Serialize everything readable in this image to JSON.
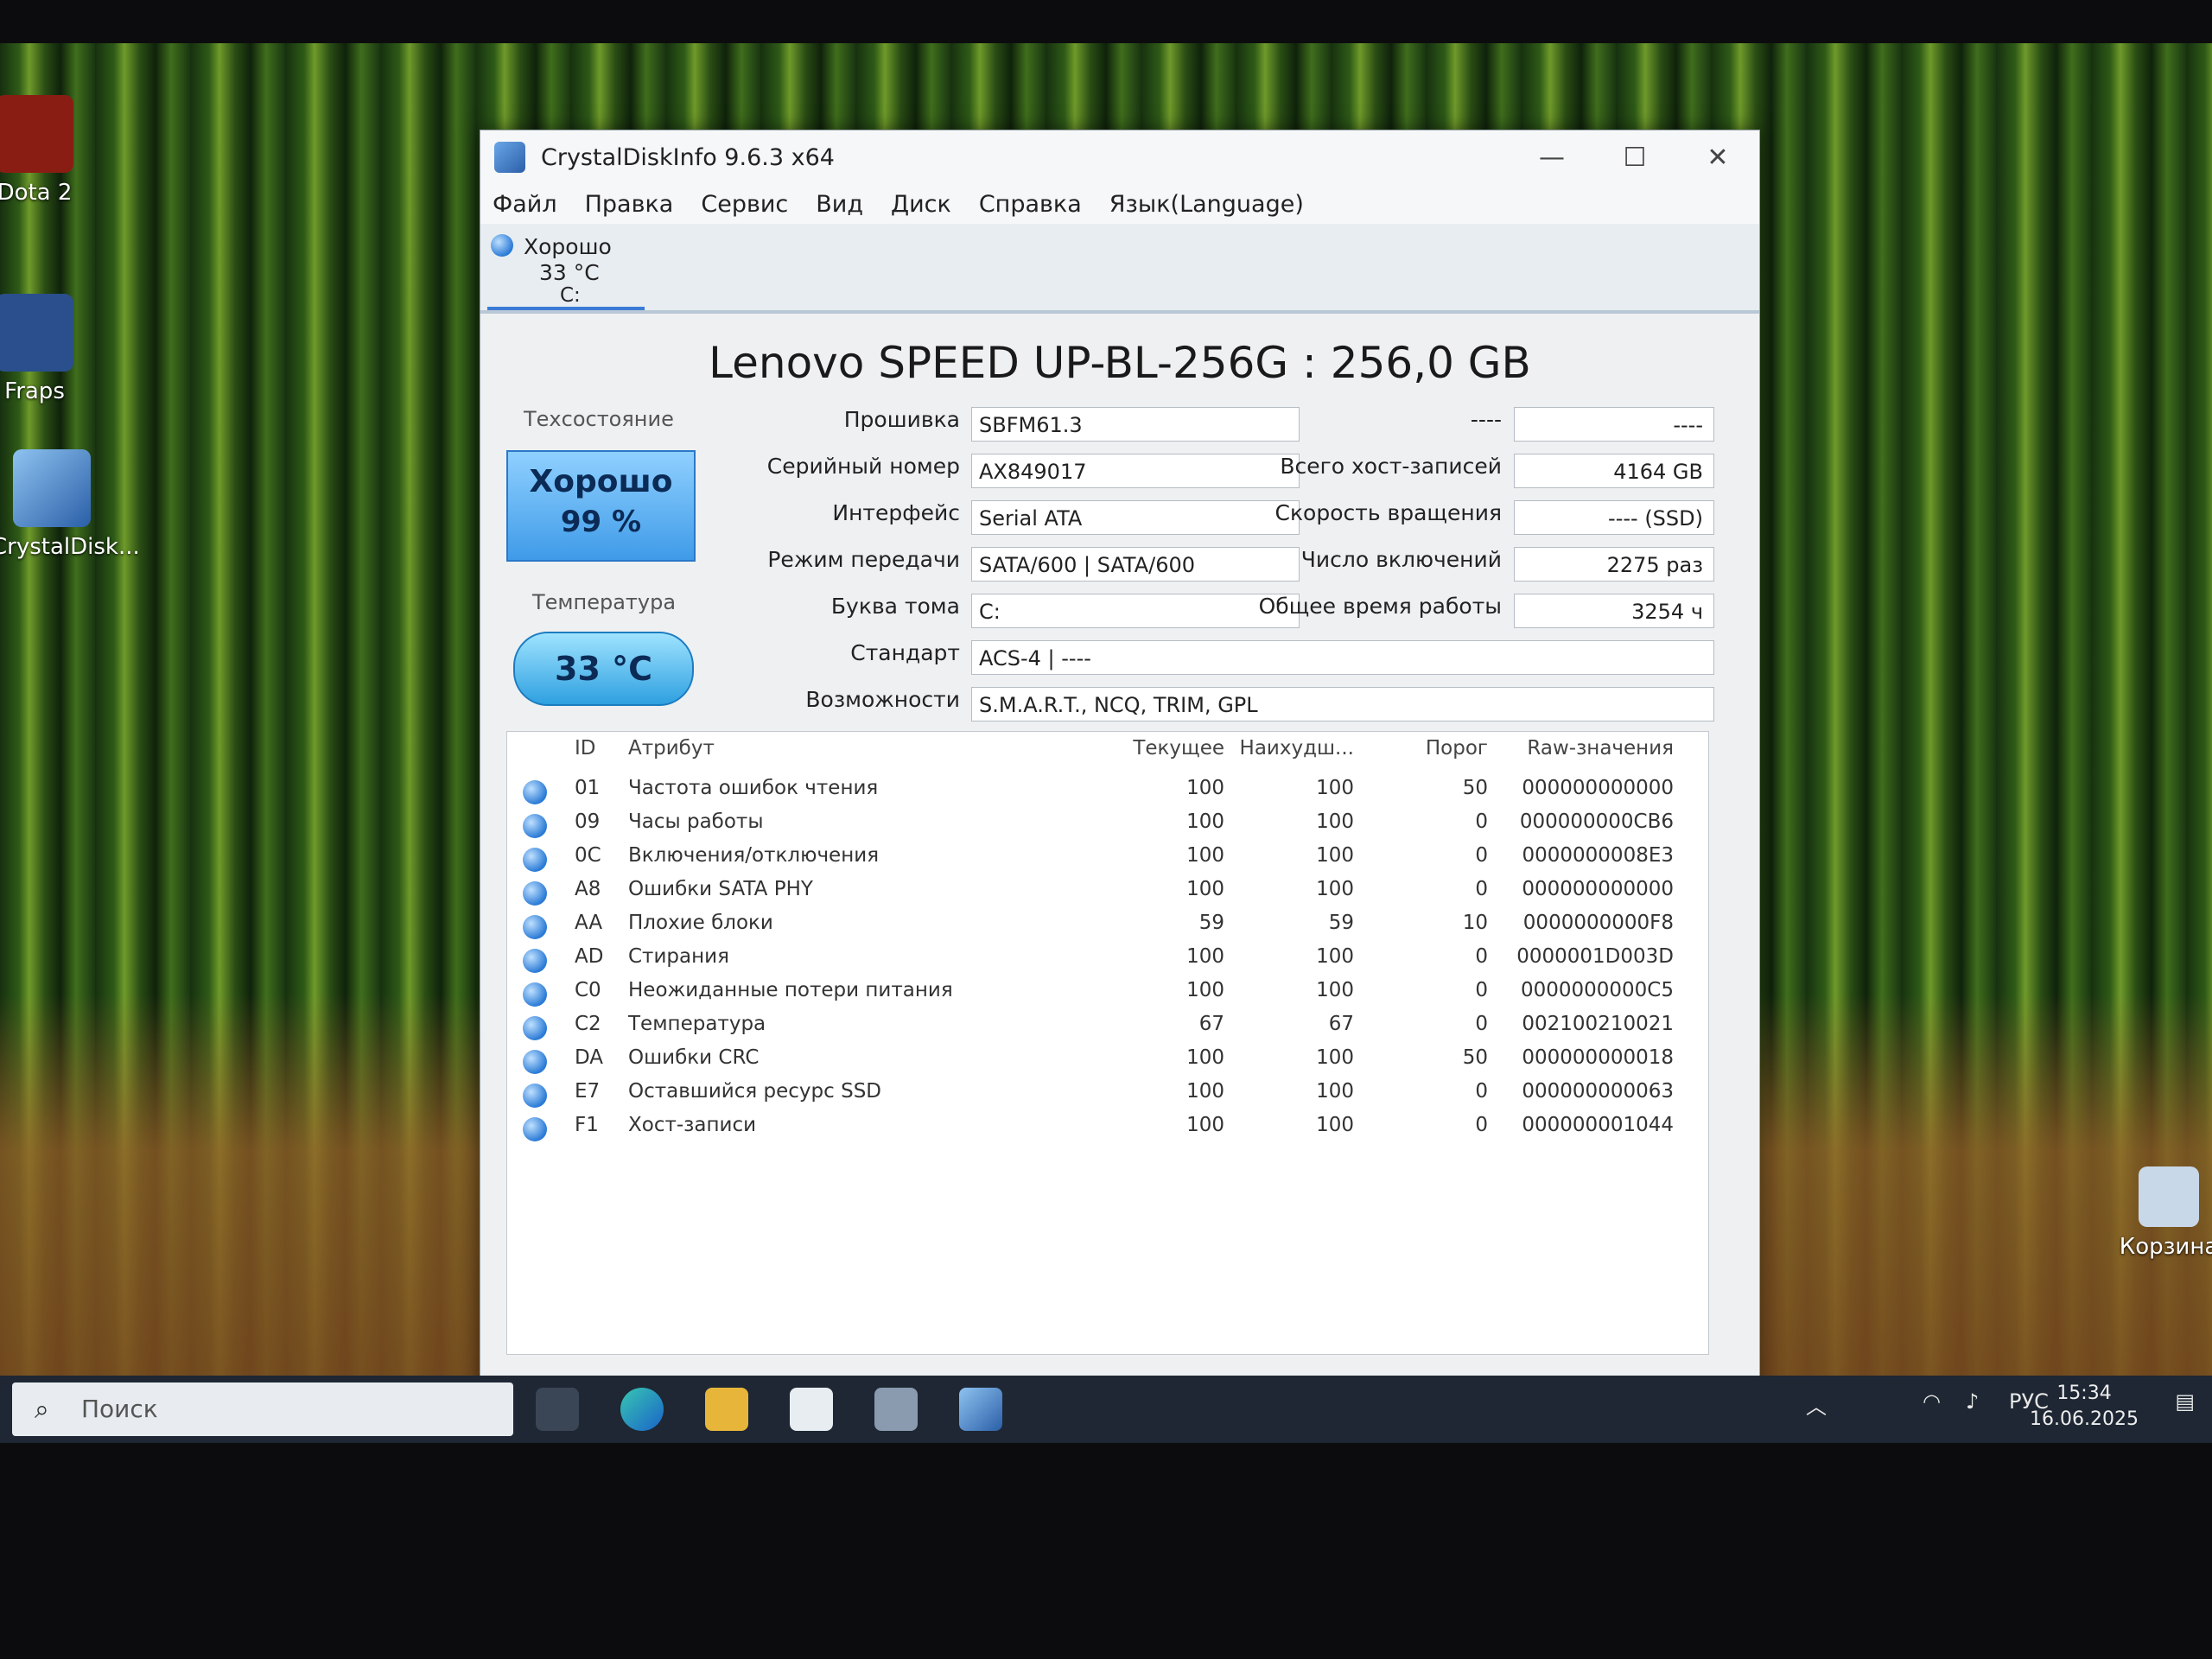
{
  "desktop": {
    "icons": [
      {
        "label": "Dota 2"
      },
      {
        "label": "Fraps"
      },
      {
        "label": "CrystalDisk..."
      },
      {
        "label": "Корзина"
      }
    ]
  },
  "window": {
    "title": "CrystalDiskInfo 9.6.3 x64",
    "minimize": "—",
    "maximize": "☐",
    "close": "✕"
  },
  "menu": [
    "Файл",
    "Правка",
    "Сервис",
    "Вид",
    "Диск",
    "Справка",
    "Язык(Language)"
  ],
  "disk_tab": {
    "status": "Хорошо",
    "temp": "33 °C",
    "letter": "C:"
  },
  "model": "Lenovo SPEED UP-BL-256G : 256,0 GB",
  "health": {
    "label": "Техсостояние",
    "status": "Хорошо",
    "percent": "99 %"
  },
  "temperature": {
    "label": "Температура",
    "value": "33 °C"
  },
  "info_left": [
    {
      "key": "Прошивка",
      "value": "SBFM61.3"
    },
    {
      "key": "Серийный номер",
      "value": "AX849017"
    },
    {
      "key": "Интерфейс",
      "value": "Serial ATA"
    },
    {
      "key": "Режим передачи",
      "value": "SATA/600 | SATA/600"
    },
    {
      "key": "Буква тома",
      "value": "C:"
    },
    {
      "key": "Стандарт",
      "value": "ACS-4 | ----"
    },
    {
      "key": "Возможности",
      "value": "S.M.A.R.T., NCQ, TRIM, GPL"
    }
  ],
  "info_right": [
    {
      "key": "----",
      "value": "----"
    },
    {
      "key": "Всего хост-записей",
      "value": "4164 GB"
    },
    {
      "key": "Скорость вращения",
      "value": "---- (SSD)"
    },
    {
      "key": "Число включений",
      "value": "2275 раз"
    },
    {
      "key": "Общее время работы",
      "value": "3254 ч"
    }
  ],
  "smart": {
    "headers": {
      "id": "ID",
      "attr": "Атрибут",
      "cur": "Текущее",
      "worst": "Наихудш...",
      "thr": "Порог",
      "raw": "Raw-значения"
    },
    "rows": [
      {
        "id": "01",
        "attr": "Частота ошибок чтения",
        "cur": "100",
        "worst": "100",
        "thr": "50",
        "raw": "000000000000"
      },
      {
        "id": "09",
        "attr": "Часы работы",
        "cur": "100",
        "worst": "100",
        "thr": "0",
        "raw": "000000000CB6"
      },
      {
        "id": "0C",
        "attr": "Включения/отключения",
        "cur": "100",
        "worst": "100",
        "thr": "0",
        "raw": "0000000008E3"
      },
      {
        "id": "A8",
        "attr": "Ошибки SATA PHY",
        "cur": "100",
        "worst": "100",
        "thr": "0",
        "raw": "000000000000"
      },
      {
        "id": "AA",
        "attr": "Плохие блоки",
        "cur": "59",
        "worst": "59",
        "thr": "10",
        "raw": "0000000000F8"
      },
      {
        "id": "AD",
        "attr": "Стирания",
        "cur": "100",
        "worst": "100",
        "thr": "0",
        "raw": "0000001D003D"
      },
      {
        "id": "C0",
        "attr": "Неожиданные потери питания",
        "cur": "100",
        "worst": "100",
        "thr": "0",
        "raw": "0000000000C5"
      },
      {
        "id": "C2",
        "attr": "Температура",
        "cur": "67",
        "worst": "67",
        "thr": "0",
        "raw": "002100210021"
      },
      {
        "id": "DA",
        "attr": "Ошибки CRC",
        "cur": "100",
        "worst": "100",
        "thr": "50",
        "raw": "000000000018"
      },
      {
        "id": "E7",
        "attr": "Оставшийся ресурс SSD",
        "cur": "100",
        "worst": "100",
        "thr": "0",
        "raw": "000000000063"
      },
      {
        "id": "F1",
        "attr": "Хост-записи",
        "cur": "100",
        "worst": "100",
        "thr": "0",
        "raw": "000000001044"
      }
    ]
  },
  "taskbar": {
    "search_placeholder": "Поиск",
    "lang": "РУС",
    "time": "15:34",
    "date": "16.06.2025"
  },
  "colors": {
    "accent": "#2b7bd6",
    "health_good": "#3f9be8"
  }
}
